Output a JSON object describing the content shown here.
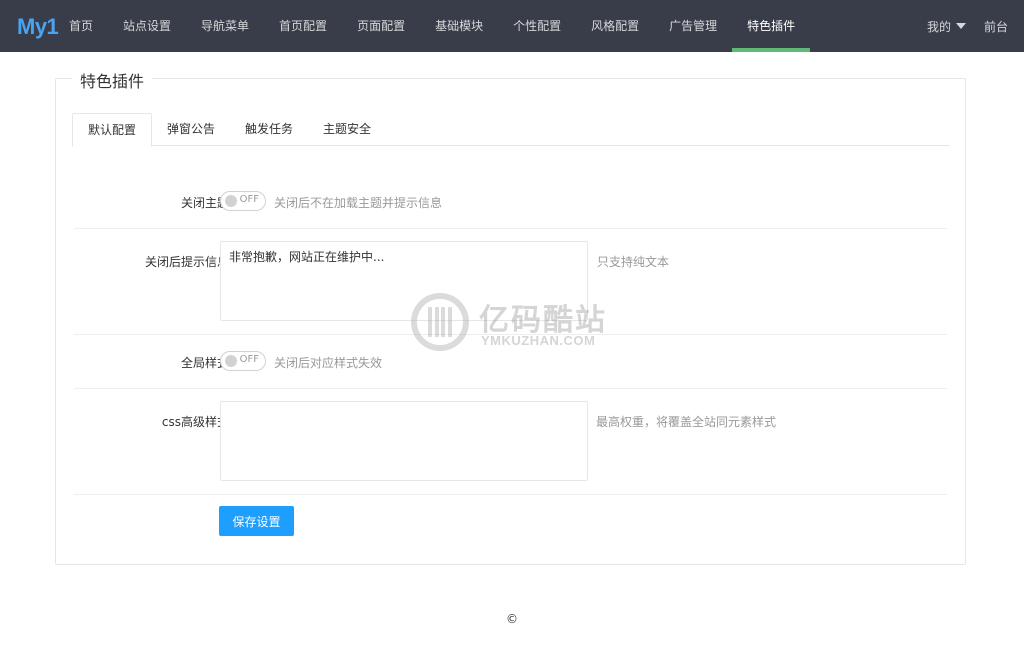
{
  "header": {
    "logo": "My1",
    "nav": [
      "首页",
      "站点设置",
      "导航菜单",
      "首页配置",
      "页面配置",
      "基础模块",
      "个性配置",
      "风格配置",
      "广告管理",
      "特色插件"
    ],
    "active_nav_index": 9,
    "user_menu": "我的",
    "frontend": "前台"
  },
  "panel": {
    "title": "特色插件",
    "tabs": [
      "默认配置",
      "弹窗公告",
      "触发任务",
      "主题安全"
    ],
    "active_tab_index": 0
  },
  "form": {
    "close_theme": {
      "label": "关闭主题",
      "switch_text": "OFF",
      "checked": false,
      "hint": "关闭后不在加载主题并提示信息"
    },
    "close_message": {
      "label": "关闭后提示信息",
      "value": "非常抱歉，网站正在维护中...",
      "hint": "只支持纯文本"
    },
    "global_style": {
      "label": "全局样式",
      "switch_text": "OFF",
      "checked": false,
      "hint": "关闭后对应样式失效"
    },
    "css_advanced": {
      "label": "css高级样式",
      "value": "",
      "hint": "最高权重，将覆盖全站同元素样式"
    },
    "save_label": "保存设置"
  },
  "watermark": {
    "cn": "亿码酷站",
    "en": "YMKUZHAN.COM"
  },
  "footer": {
    "text": "©"
  },
  "colors": {
    "topbar": "#393d49",
    "nav_active_underline": "#5fb878",
    "primary_button": "#1e9fff",
    "logo": "#4aa3f0"
  }
}
